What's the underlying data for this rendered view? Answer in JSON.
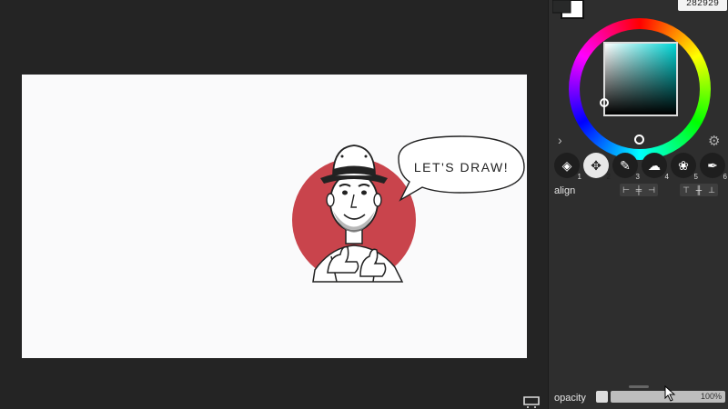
{
  "color_panel": {
    "hex_value": "282929",
    "foreground_color": "#282929",
    "background_color": "#ffffff",
    "hue_color": "#00d5d5"
  },
  "canvas": {
    "bubble_text": "LET'S DRAW!",
    "background": "#fafafb",
    "accent_color": "#c9444c"
  },
  "tools": [
    {
      "icon": "eraser-icon",
      "num": "1"
    },
    {
      "icon": "transform-icon",
      "num": "2"
    },
    {
      "icon": "brush-icon",
      "num": "3"
    },
    {
      "icon": "smudge-icon",
      "num": "4"
    },
    {
      "icon": "fill-brush-icon",
      "num": "5"
    },
    {
      "icon": "pen-icon",
      "num": "6"
    }
  ],
  "align": {
    "label": "align"
  },
  "opacity": {
    "label": "opacity",
    "value": "100%"
  }
}
